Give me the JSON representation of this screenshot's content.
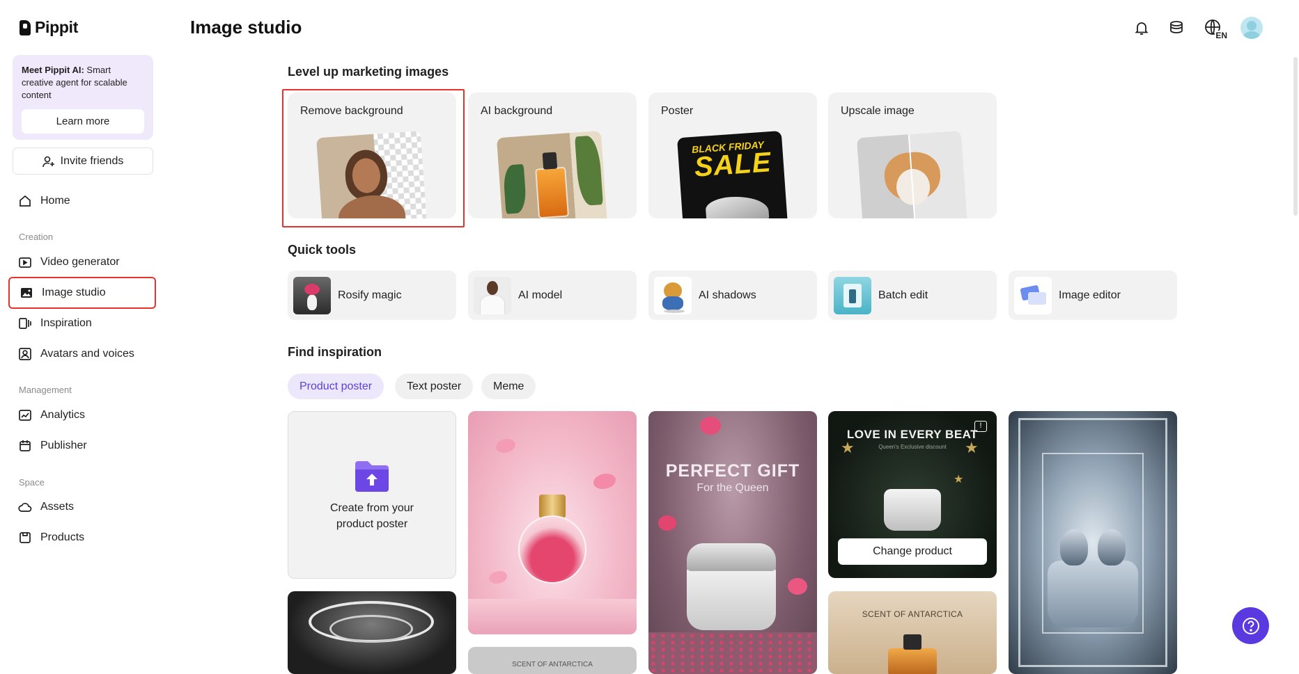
{
  "brand": {
    "name": "Pippit"
  },
  "promo": {
    "title": "Meet Pippit AI:",
    "text": "Smart creative agent for scalable content",
    "button": "Learn more"
  },
  "invite": {
    "label": "Invite friends"
  },
  "nav": {
    "home": "Home",
    "creation_label": "Creation",
    "creation": [
      "Video generator",
      "Image studio",
      "Inspiration",
      "Avatars and voices"
    ],
    "management_label": "Management",
    "management": [
      "Analytics",
      "Publisher"
    ],
    "space_label": "Space",
    "space": [
      "Assets",
      "Products"
    ],
    "active": "Image studio"
  },
  "header": {
    "title": "Image studio",
    "lang": "EN"
  },
  "sections": {
    "level_up": {
      "title": "Level up marketing images",
      "cards": [
        "Remove background",
        "AI background",
        "Poster",
        "Upscale image"
      ]
    },
    "quick_tools": {
      "title": "Quick tools",
      "tools": [
        "Rosify magic",
        "AI model",
        "AI shadows",
        "Batch edit",
        "Image editor"
      ]
    },
    "inspiration": {
      "title": "Find inspiration",
      "chips": [
        "Product poster",
        "Text poster",
        "Meme"
      ],
      "selected_chip": "Product poster",
      "create_text": "Create from your product poster",
      "tile_texts": {
        "perfect_gift": "PERFECT GIFT",
        "perfect_gift_sub": "For the Queen",
        "love_beat": "LOVE IN EVERY BEAT",
        "love_beat_sub": "Queen's Exclusive discount",
        "change_product": "Change product",
        "antarctica": "SCENT OF ANTARCTICA"
      }
    }
  },
  "poster_art": {
    "line1": "BLACK FRIDAY",
    "line2": "SALE"
  },
  "colors": {
    "accent": "#5b39e0",
    "highlight": "#e8302c",
    "chip_selected": "#ece7fb",
    "card_bg": "#f2f2f2"
  }
}
